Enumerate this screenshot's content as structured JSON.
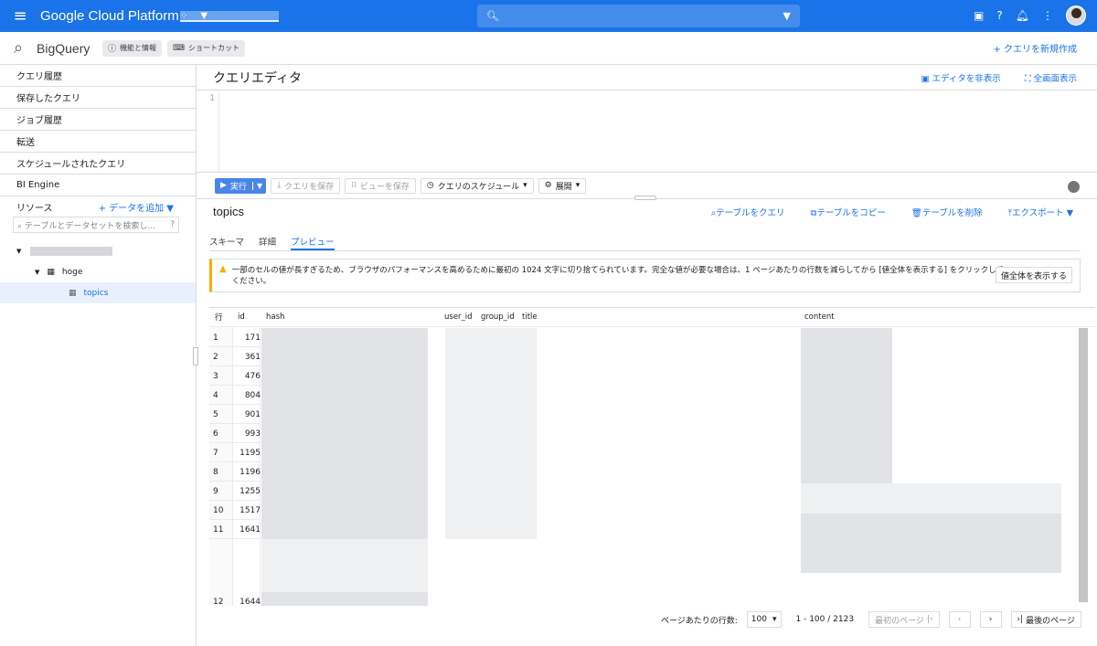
{
  "topbar": {
    "menu_icon": "hamburger-icon",
    "brand": "Google Cloud Platform",
    "project_icon": "project-dots-icon",
    "search_icon": "search-icon"
  },
  "subbar": {
    "product": "BigQuery",
    "chip_features": "機能と情報",
    "chip_shortcuts": "ショートカット",
    "new_query": "クエリを新規作成"
  },
  "sidebar": {
    "items": [
      "クエリ履歴",
      "保存したクエリ",
      "ジョブ履歴",
      "転送",
      "スケジュールされたクエリ",
      "BI Engine"
    ],
    "resources_label": "リソース",
    "add_data": "データを追加",
    "search_placeholder": "テーブルとデータセットを検索し...",
    "dataset": "hoge",
    "table": "topics"
  },
  "editor": {
    "title": "クエリエディタ",
    "hide_editor": "エディタを非表示",
    "fullscreen": "全画面表示",
    "line_number": "1"
  },
  "toolbar": {
    "run": "実行",
    "save_query": "クエリを保存",
    "save_view": "ビューを保存",
    "schedule": "クエリのスケジュール",
    "expand": "展開"
  },
  "table": {
    "name": "topics",
    "query_table": "テーブルをクエリ",
    "copy_table": "テーブルをコピー",
    "delete_table": "テーブルを削除",
    "export": "エクスポート",
    "tabs": [
      "スキーマ",
      "詳細",
      "プレビュー"
    ],
    "active_tab": "プレビュー"
  },
  "warning": {
    "text": "一部のセルの値が長すぎるため、ブラウザのパフォーマンスを高めるために最初の 1024 文字に切り捨てられています。完全な値が必要な場合は、1 ページあたりの行数を減らしてから [値全体を表示する] をクリックしてください。",
    "button": "値全体を表示する"
  },
  "grid": {
    "columns": [
      "行",
      "id",
      "hash",
      "user_id",
      "group_id",
      "title",
      "content"
    ],
    "rows": [
      {
        "row": "1",
        "id": "171"
      },
      {
        "row": "2",
        "id": "361"
      },
      {
        "row": "3",
        "id": "476"
      },
      {
        "row": "4",
        "id": "804"
      },
      {
        "row": "5",
        "id": "901"
      },
      {
        "row": "6",
        "id": "993"
      },
      {
        "row": "7",
        "id": "1195"
      },
      {
        "row": "8",
        "id": "1196"
      },
      {
        "row": "9",
        "id": "1255"
      },
      {
        "row": "10",
        "id": "1517"
      },
      {
        "row": "11",
        "id": "1641"
      },
      {
        "row": "12",
        "id": "1644"
      }
    ]
  },
  "pager": {
    "rows_per_page_label": "ページあたりの行数:",
    "rows_per_page": "100",
    "range": "1 - 100 / 2123",
    "first_page": "最初のページ",
    "last_page": "最後のページ"
  }
}
